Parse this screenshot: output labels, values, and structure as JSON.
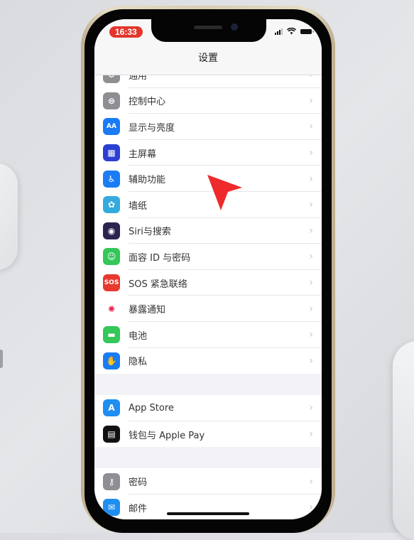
{
  "status_bar": {
    "time": "16:33"
  },
  "nav": {
    "title": "设置"
  },
  "groups": [
    [
      {
        "label": "通用",
        "icon": "gear-icon",
        "color": "#8e8e93",
        "glyph": "⚙"
      },
      {
        "label": "控制中心",
        "icon": "control-center-icon",
        "color": "#8e8e93",
        "glyph": "⊜"
      },
      {
        "label": "显示与亮度",
        "icon": "display-brightness-icon",
        "color": "#1a7cf5",
        "glyph": "AA"
      },
      {
        "label": "主屏幕",
        "icon": "home-screen-icon",
        "color": "#2c3fd4",
        "glyph": "▦"
      },
      {
        "label": "辅助功能",
        "icon": "accessibility-icon",
        "color": "#1a7cf5",
        "glyph": "♿"
      },
      {
        "label": "墙纸",
        "icon": "wallpaper-icon",
        "color": "#35aadc",
        "glyph": "✿"
      },
      {
        "label": "Siri与搜索",
        "icon": "siri-icon",
        "color": "#2b2350",
        "glyph": "◉"
      },
      {
        "label": "面容 ID 与密码",
        "icon": "face-id-icon",
        "color": "#34c759",
        "glyph": "☺"
      },
      {
        "label": "SOS 紧急联络",
        "icon": "sos-icon",
        "color": "#e8392e",
        "glyph": "SOS"
      },
      {
        "label": "暴露通知",
        "icon": "exposure-notification-icon",
        "color": "#ffffff",
        "glyph": "✺"
      },
      {
        "label": "电池",
        "icon": "battery-icon",
        "color": "#34c759",
        "glyph": "▬"
      },
      {
        "label": "隐私",
        "icon": "privacy-hand-icon",
        "color": "#1a7cf5",
        "glyph": "✋"
      }
    ],
    [
      {
        "label": "App Store",
        "icon": "app-store-icon",
        "color": "#1f8ef1",
        "glyph": "A"
      },
      {
        "label": "钱包与 Apple Pay",
        "icon": "wallet-icon",
        "color": "#111111",
        "glyph": "▤"
      }
    ],
    [
      {
        "label": "密码",
        "icon": "key-icon",
        "color": "#8e8e93",
        "glyph": "⚷"
      },
      {
        "label": "邮件",
        "icon": "mail-icon",
        "color": "#1f8ef1",
        "glyph": "✉"
      }
    ]
  ],
  "chevron": "›"
}
